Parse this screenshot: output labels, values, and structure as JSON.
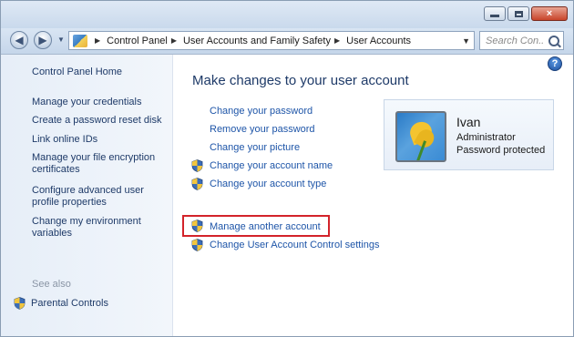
{
  "window": {
    "close_glyph": "×"
  },
  "navigation": {
    "breadcrumb": [
      "Control Panel",
      "User Accounts and Family Safety",
      "User Accounts"
    ],
    "search_placeholder": "Search Con..."
  },
  "sidebar": {
    "links": [
      "Control Panel Home",
      "Manage your credentials",
      "Create a password reset disk",
      "Link online IDs",
      "Manage your file encryption certificates",
      "Configure advanced user profile properties",
      "Change my environment variables"
    ],
    "see_also_label": "See also",
    "see_also_links": [
      "Parental Controls"
    ]
  },
  "main": {
    "heading": "Make changes to your user account",
    "tasks": [
      {
        "label": "Change your password",
        "shield": false
      },
      {
        "label": "Remove your password",
        "shield": false
      },
      {
        "label": "Change your picture",
        "shield": false
      },
      {
        "label": "Change your account name",
        "shield": true
      },
      {
        "label": "Change your account type",
        "shield": true
      }
    ],
    "other_tasks": [
      {
        "label": "Manage another account",
        "shield": true,
        "highlighted": true
      },
      {
        "label": "Change User Account Control settings",
        "shield": true
      }
    ]
  },
  "account": {
    "name": "Ivan",
    "role": "Administrator",
    "status": "Password protected"
  },
  "help": {
    "glyph": "?"
  },
  "icons": {
    "back": "back-arrow-icon",
    "forward": "forward-arrow-icon",
    "refresh": "refresh-icon",
    "search": "search-icon",
    "uac": "uac-shield-icon",
    "help": "help-icon"
  },
  "colors": {
    "link": "#1e55a8",
    "heading": "#1e3a68",
    "highlight_border": "#d3232a"
  }
}
